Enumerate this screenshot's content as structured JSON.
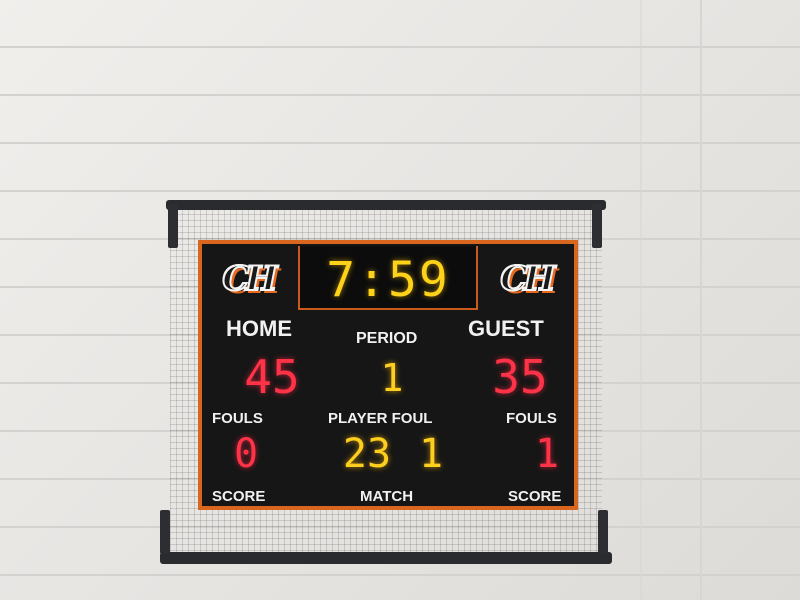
{
  "scoreboard": {
    "clock": "7:59",
    "home_label": "HOME",
    "guest_label": "GUEST",
    "period_label": "PERIOD",
    "period": "1",
    "home_score": "45",
    "guest_score": "35",
    "fouls_label": "FOULS",
    "home_fouls": "0",
    "guest_fouls": "1",
    "player_foul_label": "PLAYER FOUL",
    "player_number": "23",
    "player_fouls": "1",
    "score_label": "SCORE",
    "match_label": "MATCH",
    "logo_text": "CH"
  },
  "colors": {
    "border": "#d9661f",
    "red_digits": "#ff3347",
    "amber_digits": "#ffcf1f"
  }
}
